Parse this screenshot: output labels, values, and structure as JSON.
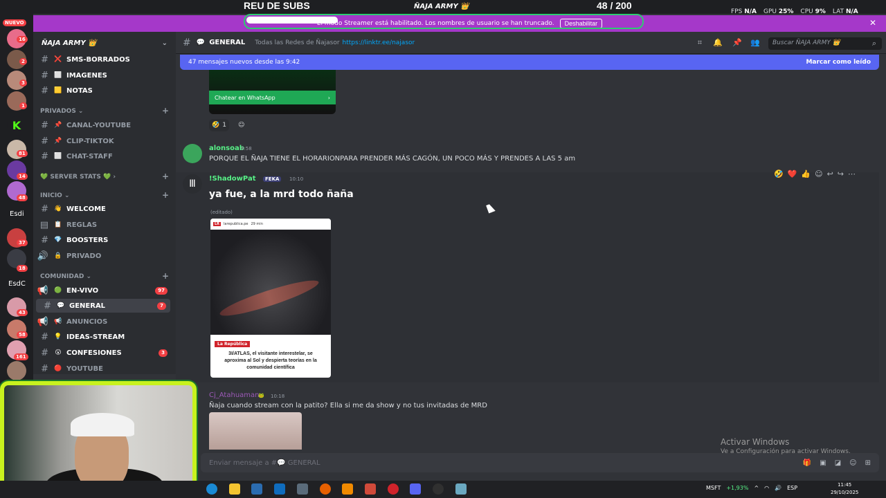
{
  "overlay": {
    "title": "REU DE SUBS",
    "count": "48",
    "goal": "/ 200",
    "server_label": "ÑAJA ARMY 👑",
    "stats": [
      {
        "k": "FPS",
        "v": "N/A"
      },
      {
        "k": "GPU",
        "v": "25%"
      },
      {
        "k": "CPU",
        "v": "9%"
      },
      {
        "k": "LAT",
        "v": "N/A"
      }
    ]
  },
  "banner": {
    "text": "El modo Streamer está habilitado. Los nombres de usuario se han truncado.",
    "button": "Deshabilitar",
    "close": "✕"
  },
  "rail": {
    "nuevo": "NUEVO",
    "badges": [
      "16",
      "2",
      "3",
      "1",
      "81",
      "14",
      "48",
      "37",
      "18",
      "43",
      "58",
      "161"
    ],
    "texts": [
      "Esdi",
      "EsdC"
    ]
  },
  "sidebar": {
    "server_name": "ÑAJA ARMY 👑",
    "channels_top": [
      {
        "em": "❌",
        "label": "SMS-BORRADOS"
      },
      {
        "em": "⬜",
        "label": "IMAGENES"
      },
      {
        "em": "🟨",
        "label": "NOTAS"
      }
    ],
    "cat_privados": "PRIVADOS ⌄",
    "channels_priv": [
      {
        "em": "📌",
        "label": "CANAL-YOUTUBE"
      },
      {
        "em": "📌",
        "label": "CLIP-TIKTOK"
      },
      {
        "em": "⬜",
        "label": "CHAT-STAFF"
      }
    ],
    "cat_stats": "💚 SERVER STATS 💚 ›",
    "cat_inicio": "INICIO ⌄",
    "channels_inicio": [
      {
        "em": "👋",
        "label": "WELCOME"
      },
      {
        "em": "📋",
        "label": "REGLAS"
      },
      {
        "em": "💎",
        "label": "BOOSTERS"
      },
      {
        "em": "🔒",
        "label": "PRIVADO"
      }
    ],
    "cat_comunidad": "COMUNIDAD ⌄",
    "channels_com": [
      {
        "em": "🟢",
        "label": "EN-VIVO",
        "badge": "97"
      },
      {
        "em": "💬",
        "label": "GENERAL",
        "badge": "7"
      },
      {
        "em": "📢",
        "label": "ANUNCIOS",
        "badge": ""
      },
      {
        "em": "💡",
        "label": "IDEAS-STREAM",
        "badge": ""
      },
      {
        "em": "😮",
        "label": "CONFESIONES",
        "badge": "3"
      },
      {
        "em": "🔴",
        "label": "YOUTUBE",
        "badge": ""
      }
    ]
  },
  "header": {
    "channel": "GENERAL",
    "topic": "Todas las Redes de Ñajasor",
    "link": "https://linktr.ee/najasor",
    "search_placeholder": "Buscar ÑAJA ARMY 👑"
  },
  "newbar": {
    "text": "47 mensajes nuevos desde las 9:42",
    "action": "Marcar como leído"
  },
  "messages": {
    "wa_button": "Chatear en WhatsApp",
    "reaction_count": "1",
    "m1": {
      "user": "alonsoab",
      "time": "9:58",
      "text": "PORQUE EL ÑAJA TIENE EL HORARIONPARA PRENDER MÁS CAGÓN, UN POCO MÁS Y PRENDES A LAS 5 am"
    },
    "m2": {
      "user": "!ShadowPat",
      "tag": "FEKA",
      "time": "10:10",
      "text": "ya fue, a la mrd todo ñaña",
      "edited": "(editado)",
      "news_source": "larepublica.pe",
      "news_time": "29 min",
      "news_tag": "La República",
      "news_caption": "3I/ATLAS, el visitante interestelar, se aproxima al Sol y despierta teorías en la comunidad científica"
    },
    "m3": {
      "user": "Cj_Atahuaman",
      "time": "10:18",
      "text": "Ñaja cuando stream con la patito? Ella si me da show y no tus invitadas de MRD"
    }
  },
  "composer": {
    "placeholder": "Enviar mensaje a #💬 GENERAL"
  },
  "windows": {
    "activate_title": "Activar Windows",
    "activate_sub": "Ve a Configuración para activar Windows."
  },
  "taskbar": {
    "stock": "MSFT",
    "stock_change": "+1,93%",
    "lang": "ESP",
    "time": "11:45",
    "date": "29/10/2025"
  },
  "colors": {
    "accent": "#5865f2",
    "banner": "#a538c9",
    "mention_red": "#f23f43",
    "webcam_border": "#c8f21e"
  }
}
